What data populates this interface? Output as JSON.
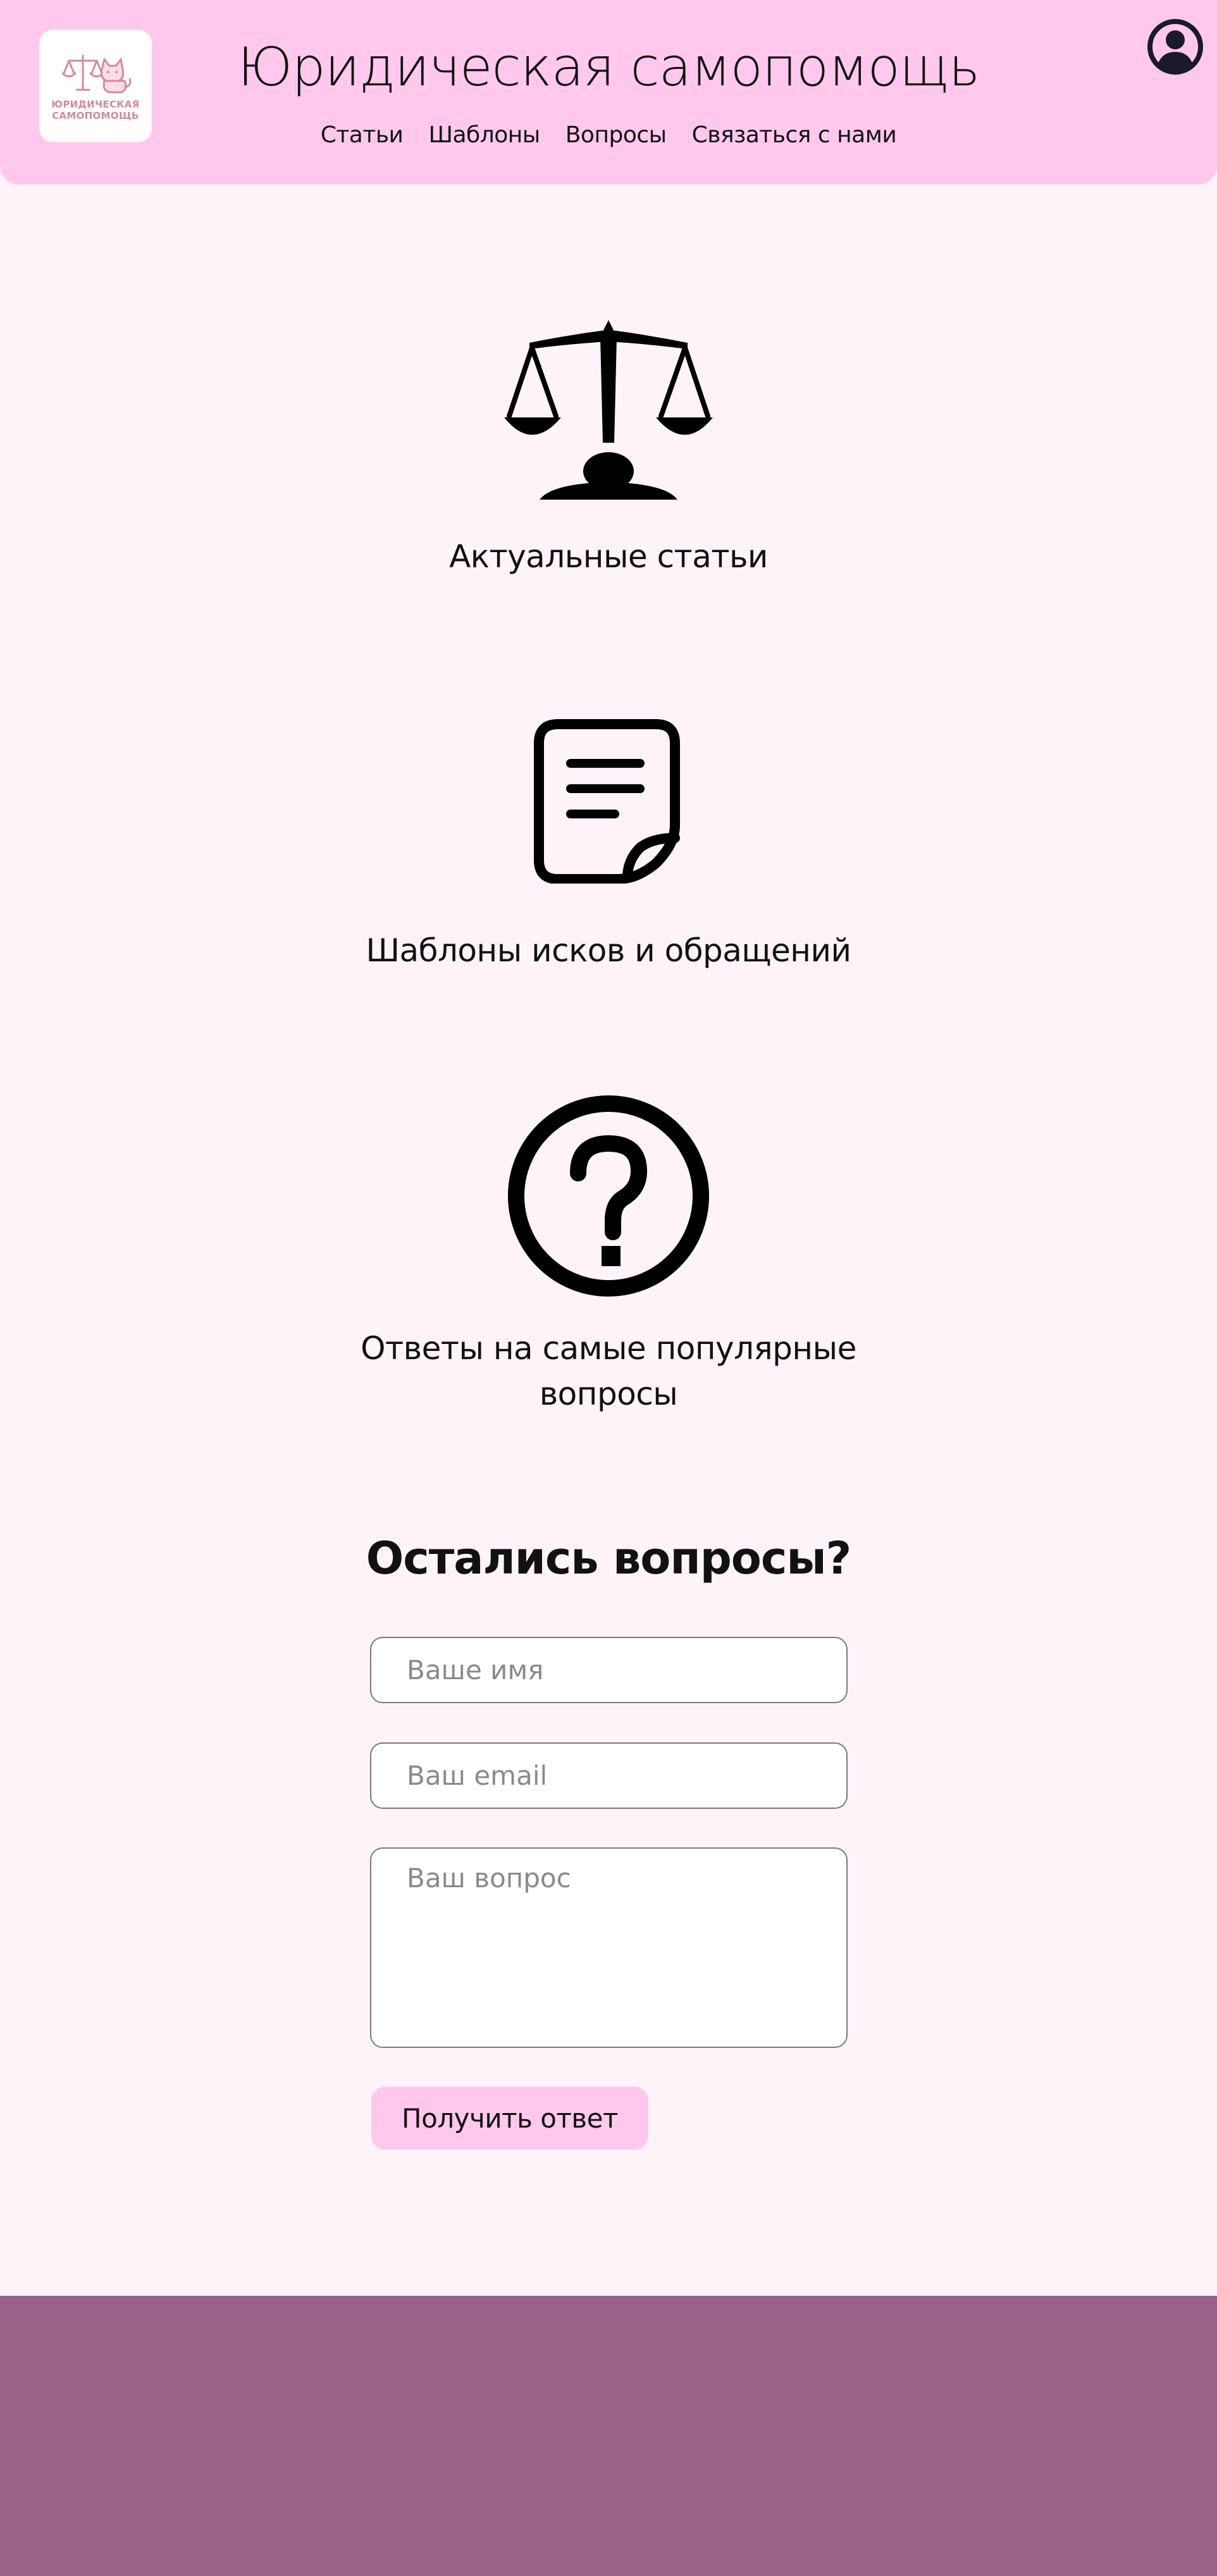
{
  "header": {
    "logo_text_line1": "ЮРИДИЧЕСКАЯ",
    "logo_text_line2": "САМОПОМОЩЬ",
    "title": "Юридическая самопомощь",
    "nav": [
      {
        "label": "Статьи"
      },
      {
        "label": "Шаблоны"
      },
      {
        "label": "Вопросы"
      },
      {
        "label": "Связаться с нами"
      }
    ],
    "profile_icon": "user-circle-icon"
  },
  "features": [
    {
      "icon": "scales-icon",
      "label": "Актуальные статьи"
    },
    {
      "icon": "document-icon",
      "label": "Шаблоны исков и обращений"
    },
    {
      "icon": "question-circle-icon",
      "label": "Ответы на самые популярные вопросы"
    }
  ],
  "form": {
    "title": "Остались вопросы?",
    "name_placeholder": "Ваше имя",
    "email_placeholder": "Ваш email",
    "question_placeholder": "Ваш вопрос",
    "submit_label": "Получить ответ"
  },
  "colors": {
    "header_bg": "#ffc8ec",
    "page_bg": "#fdf3f9",
    "footer_bg": "#9b6289",
    "button_bg": "#ffc8ec",
    "logo_accent": "#d48a97"
  }
}
